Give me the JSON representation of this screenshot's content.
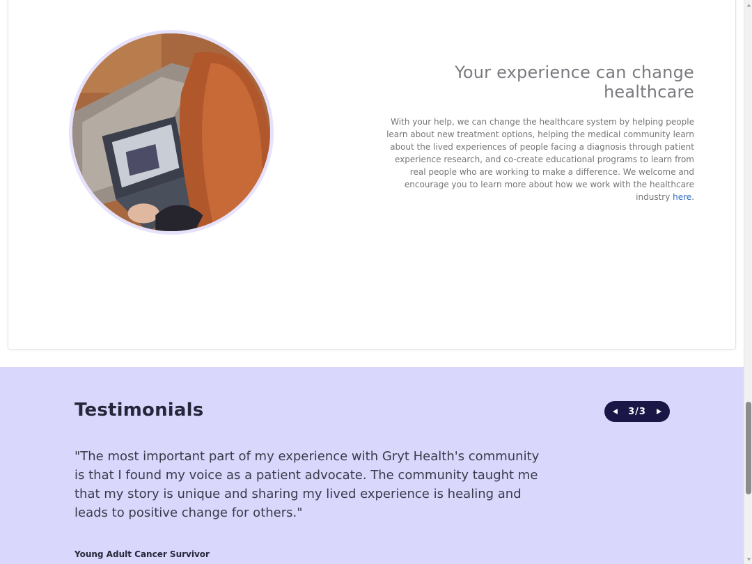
{
  "hero": {
    "image_alt": "Woman on a video call with a laptop",
    "headline": "Your experience can change healthcare",
    "body": "With your help, we can change the healthcare system by helping people learn about new treatment options, helping the medical community learn about the lived experiences of people facing a diagnosis through patient experience research, and co-create educational programs to learn from real people who are working to make a difference. We welcome and encourage you to learn more about how we work with the healthcare industry ",
    "link_text": "here",
    "after_link": "."
  },
  "testimonials": {
    "title": "Testimonials",
    "pager": {
      "current": 3,
      "total": 3,
      "label": "3/3",
      "prev_icon": "triangle-left-icon",
      "next_icon": "triangle-right-icon"
    },
    "quote": "\"The most important part of my experience with Gryt Health's community is that I found my voice as a patient advocate. The community taught me that my story is unique and sharing my lived experience is healing and leads to positive change for others.\"",
    "attribution": "Young Adult Cancer Survivor"
  },
  "colors": {
    "testimonial_bg": "#d9d7fc",
    "pager_bg": "#1a1747",
    "link": "#2f6fc9",
    "ring": "#e6e2fb"
  },
  "scrollbar": {
    "up_icon": "scroll-up-icon",
    "down_icon": "scroll-down-icon"
  }
}
